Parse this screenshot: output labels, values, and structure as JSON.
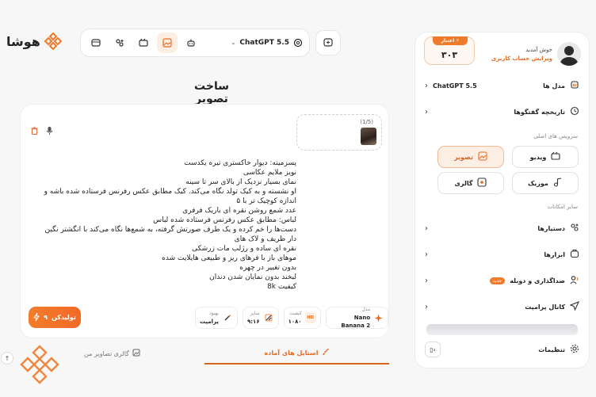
{
  "brand": {
    "name": "هوشا",
    "accent": "#f07a2b"
  },
  "toolbar": {
    "model": "ChatGPT 5.5",
    "icons": [
      "chat-icon",
      "agent-icon",
      "video-icon",
      "image-icon",
      "robot-icon"
    ],
    "extra_icon": "new-chat-icon"
  },
  "page": {
    "title": "ساخت تصویر"
  },
  "upload": {
    "count": "(1/5)"
  },
  "prompt": {
    "text": "پسزمینه: دیوار خاکستری تیره یکدست\nنویز ملایم عکاسی\nنمای بسیار نزدیک از بالای سر تا سینه\nاو نشسته و به کیک تولد نگاه می‌کند. کیک مطابق عکس رفرنس فرستاده شده باشه و اندازه کوچیک تر با ۵\nعدد شمع روشن نقره ای باریک فرفری\nلباس: مطابق عکس رفرنس فرستاده شده لباس\nدست‌ها را خم کرده و یک طرف صورتش گرفته، به شمع‌ها نگاه می‌کند با انگشتر نگین دار ظریف و لاک های\nنقره ای ساده و رژلب مات زرشکی\nموهای باز با فرهای ریز و طبیعی هایلایت شده\nبدون تغییر در چهره\nلبخند بدون نمایان شدن دندان\nکیفیت 8k"
  },
  "options": [
    {
      "key": "مدل",
      "value": "Nano Banana 2",
      "icon": "sparkle-icon"
    },
    {
      "key": "کیفیت",
      "value": "۱۰۸۰",
      "icon": "hd-icon"
    },
    {
      "key": "سایز",
      "value": "۹:۱۶",
      "icon": "ratio-icon"
    },
    {
      "key": "بهبود",
      "value": "پرامپت",
      "icon": "magic-wand-icon"
    }
  ],
  "generate": {
    "label": "تولیدکن",
    "cost": "۹"
  },
  "tabs": [
    {
      "label": "گالری تصاویر من",
      "icon": "gallery-icon",
      "active": false
    },
    {
      "label": "استایل های آماده",
      "icon": "brush-icon",
      "active": true
    }
  ],
  "sidebar": {
    "welcome": "خوش آمدید",
    "edit_account": "ویرایش حساب کاربری",
    "credit_label": "اعتبار",
    "credit_value": "۳۰۳",
    "model_label": "مدل ها",
    "model_value": "ChatGPT 5.5",
    "history_label": "تاریخچه گفتگوها",
    "main_services_title": "سرویس های اصلی",
    "services": [
      {
        "label": "تصویر",
        "icon": "image-icon",
        "active": true
      },
      {
        "label": "ویدیو",
        "icon": "video-icon",
        "active": false
      },
      {
        "label": "گالری",
        "icon": "gallery-icon",
        "active": false
      },
      {
        "label": "موزیک",
        "icon": "music-icon",
        "active": false
      }
    ],
    "other_title": "سایر امکانات",
    "other_items": [
      {
        "label": "دستیارها",
        "icon": "assistant-icon"
      },
      {
        "label": "ابزارها",
        "icon": "tools-icon"
      },
      {
        "label": "صداگذاری و دوبله",
        "icon": "voice-icon",
        "badge": "جدید"
      },
      {
        "label": "کانال پرامپت",
        "icon": "send-icon"
      }
    ],
    "settings_label": "تنظیمات"
  }
}
